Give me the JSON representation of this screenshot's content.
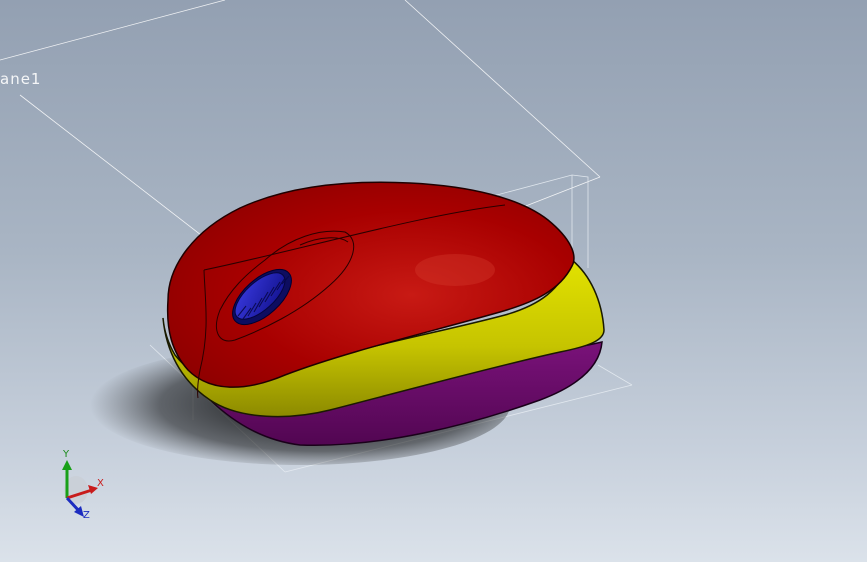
{
  "viewport": {
    "plane_label": "ane1",
    "triad": {
      "x_label": "X",
      "y_label": "Y",
      "z_label": "Z"
    }
  },
  "model": {
    "parts": [
      "top-shell",
      "side-band",
      "bottom-shell",
      "scroll-wheel"
    ],
    "colors": {
      "top_shell": "#b30000",
      "side_band": "#c8c800",
      "bottom_shell": "#6a0a6a",
      "scroll_wheel": "#1a1ab0",
      "axis_x": "#d42020",
      "axis_y": "#20b020",
      "axis_z": "#2030c0"
    }
  }
}
